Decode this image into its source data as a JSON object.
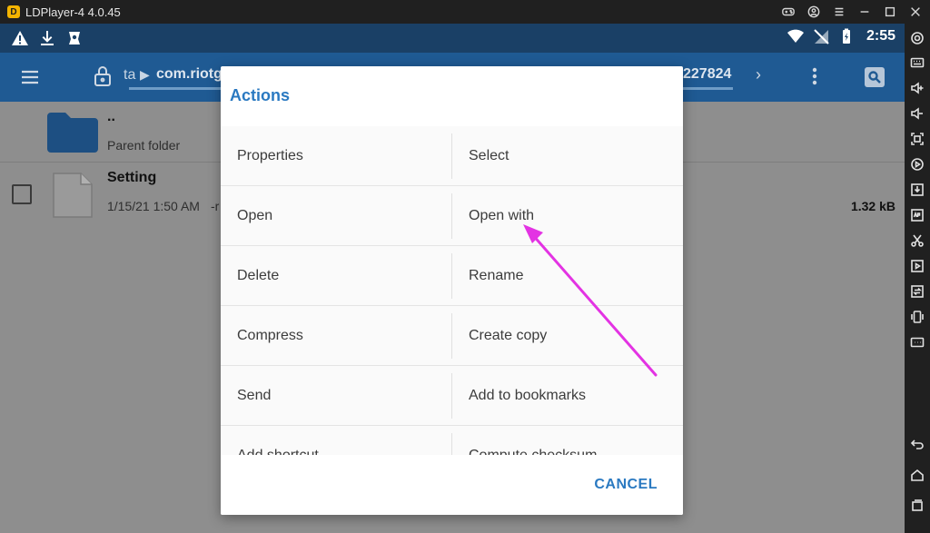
{
  "window": {
    "title": "LDPlayer-4 4.0.45",
    "controls": [
      "gamepad-icon",
      "account-icon",
      "menu-icon",
      "minimize-icon",
      "maximize-icon",
      "close-icon"
    ]
  },
  "statusbar": {
    "time": "2:55",
    "left_icons": [
      "warning-icon",
      "download-icon",
      "app-notification-icon"
    ],
    "right_icons": [
      "wifi-icon",
      "no-signal-icon",
      "battery-icon"
    ]
  },
  "appbar": {
    "crumb_prev": "ta",
    "crumb_separator": "▶",
    "crumb_current": "com.riotg",
    "crumb_tail": "227824",
    "next_glyph": "›"
  },
  "filelist": {
    "parent": {
      "name": "..",
      "label": "Parent folder"
    },
    "file": {
      "name": "Setting",
      "date": "1/15/21 1:50 AM",
      "perm": "-r",
      "size": "1.32 kB"
    }
  },
  "dialog": {
    "title": "Actions",
    "rows": [
      [
        "Properties",
        "Select"
      ],
      [
        "Open",
        "Open with"
      ],
      [
        "Delete",
        "Rename"
      ],
      [
        "Compress",
        "Create copy"
      ],
      [
        "Send",
        "Add to bookmarks"
      ],
      [
        "Add shortcut",
        "Compute checksum"
      ]
    ],
    "cancel_label": "CANCEL"
  },
  "colors": {
    "statusbar": "#1a4066",
    "appbar": "#1f5a93",
    "accent": "#2a79c1",
    "annotation_arrow": "#e333e3"
  },
  "sidebar_icons": [
    "settings-icon",
    "keyboard-icon",
    "volume-up-icon",
    "volume-down-icon",
    "screenshot-icon",
    "record-icon",
    "install-icon",
    "apk-icon",
    "scissors-icon",
    "video-icon",
    "sync-icon",
    "shake-icon",
    "more-icon",
    "back-icon",
    "home-icon",
    "recents-icon"
  ]
}
